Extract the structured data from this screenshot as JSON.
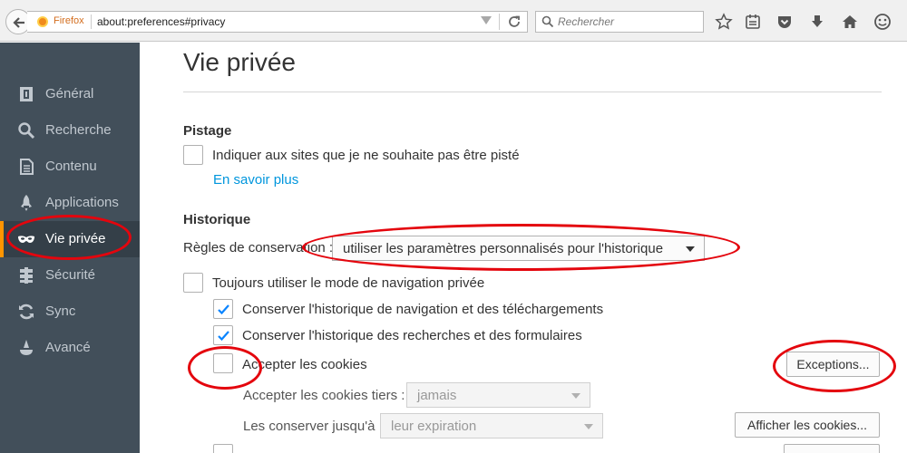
{
  "browser": {
    "identity_label": "Firefox",
    "url": "about:preferences#privacy",
    "search_placeholder": "Rechercher",
    "toolbar_icons": [
      "bookmark-star-icon",
      "reading-list-icon",
      "pocket-icon",
      "download-icon",
      "home-icon",
      "hello-icon"
    ]
  },
  "sidebar": {
    "items": [
      {
        "label": "Général",
        "icon": "general-icon"
      },
      {
        "label": "Recherche",
        "icon": "search-icon"
      },
      {
        "label": "Contenu",
        "icon": "content-icon"
      },
      {
        "label": "Applications",
        "icon": "applications-icon"
      },
      {
        "label": "Vie privée",
        "icon": "privacy-mask-icon",
        "selected": true
      },
      {
        "label": "Sécurité",
        "icon": "security-icon"
      },
      {
        "label": "Sync",
        "icon": "sync-icon"
      },
      {
        "label": "Avancé",
        "icon": "advanced-icon"
      }
    ]
  },
  "main": {
    "title": "Vie privée",
    "tracking": {
      "heading": "Pistage",
      "dnt_label": "Indiquer aux sites que je ne souhaite pas être pisté",
      "dnt_checked": false,
      "learn_more": "En savoir plus"
    },
    "history": {
      "heading": "Historique",
      "rules_label": "Règles de conservation :",
      "rules_value": "utiliser les paramètres personnalisés pour l'historique",
      "always_private_label": "Toujours utiliser le mode de navigation privée",
      "always_private_checked": false,
      "keep_history_label": "Conserver l'historique de navigation et des téléchargements",
      "keep_history_checked": true,
      "keep_search_label": "Conserver l'historique des recherches et des formulaires",
      "keep_search_checked": true,
      "accept_cookies_label": "Accepter les cookies",
      "accept_cookies_checked": false,
      "exceptions_button": "Exceptions...",
      "third_party_label": "Accepter les cookies tiers :",
      "third_party_value": "jamais",
      "keep_until_label": "Les conserver jusqu'à :",
      "keep_until_value": "leur expiration",
      "show_cookies_button": "Afficher les cookies..."
    }
  },
  "colors": {
    "sidebar_bg": "#424f5a",
    "sidebar_selected_bg": "#343f48",
    "selected_accent": "#ff9500",
    "link": "#0096dd",
    "checkmark": "#0a84ff",
    "annotation": "#e4050d"
  }
}
